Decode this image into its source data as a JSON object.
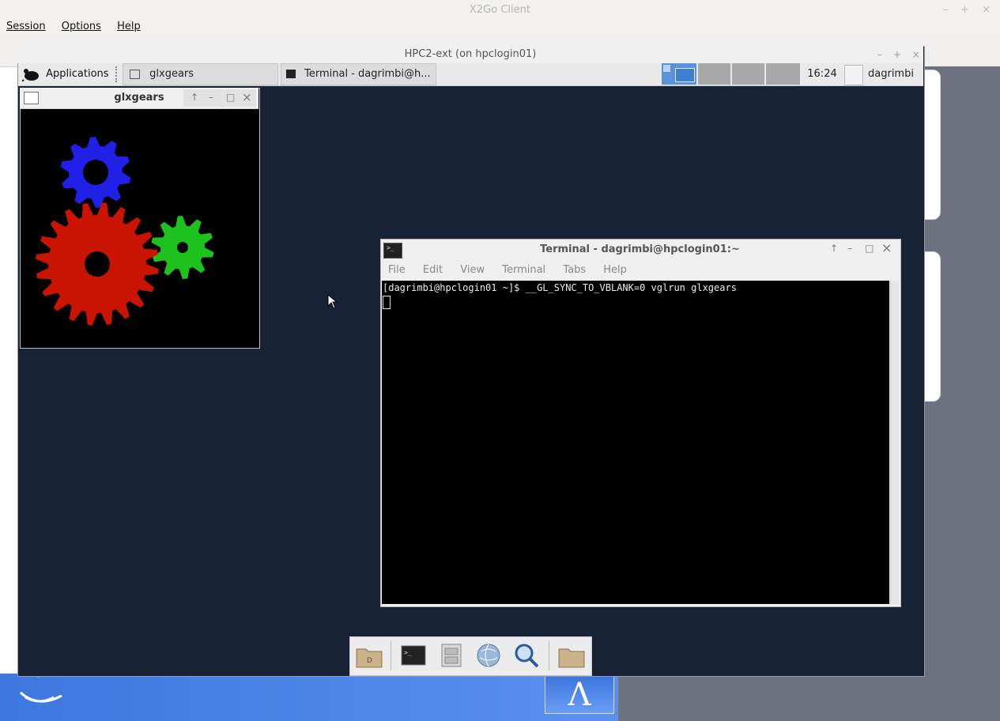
{
  "x2go": {
    "title": "X2Go Client",
    "controls": [
      "–",
      "+",
      "×"
    ],
    "menu": [
      "Session",
      "Options",
      "Help"
    ]
  },
  "session": {
    "title": "HPC2-ext (on hpclogin01)",
    "controls": [
      "–",
      "+",
      "×"
    ]
  },
  "panel": {
    "applications_label": "Applications",
    "tasks": [
      {
        "label": "glxgears"
      },
      {
        "label": "Terminal - dagrimbi@h..."
      }
    ],
    "clock": "16:24",
    "user": "dagrimbi"
  },
  "glxgears": {
    "title": "glxgears",
    "gear_colors": {
      "red": "#c81400",
      "green": "#1ec21e",
      "blue": "#2020e6"
    }
  },
  "terminal": {
    "title": "Terminal - dagrimbi@hpclogin01:~",
    "menu": [
      "File",
      "Edit",
      "View",
      "Terminal",
      "Tabs",
      "Help"
    ],
    "lines": [
      "[dagrimbi@hpclogin01 ~]$ __GL_SYNC_TO_VBLANK=0 vglrun glxgears"
    ]
  },
  "dock": {
    "items": [
      "home-folder-icon",
      "terminal-icon",
      "file-manager-icon",
      "web-browser-icon",
      "search-icon",
      "folder-icon"
    ]
  },
  "lambda_logo": "Λ"
}
